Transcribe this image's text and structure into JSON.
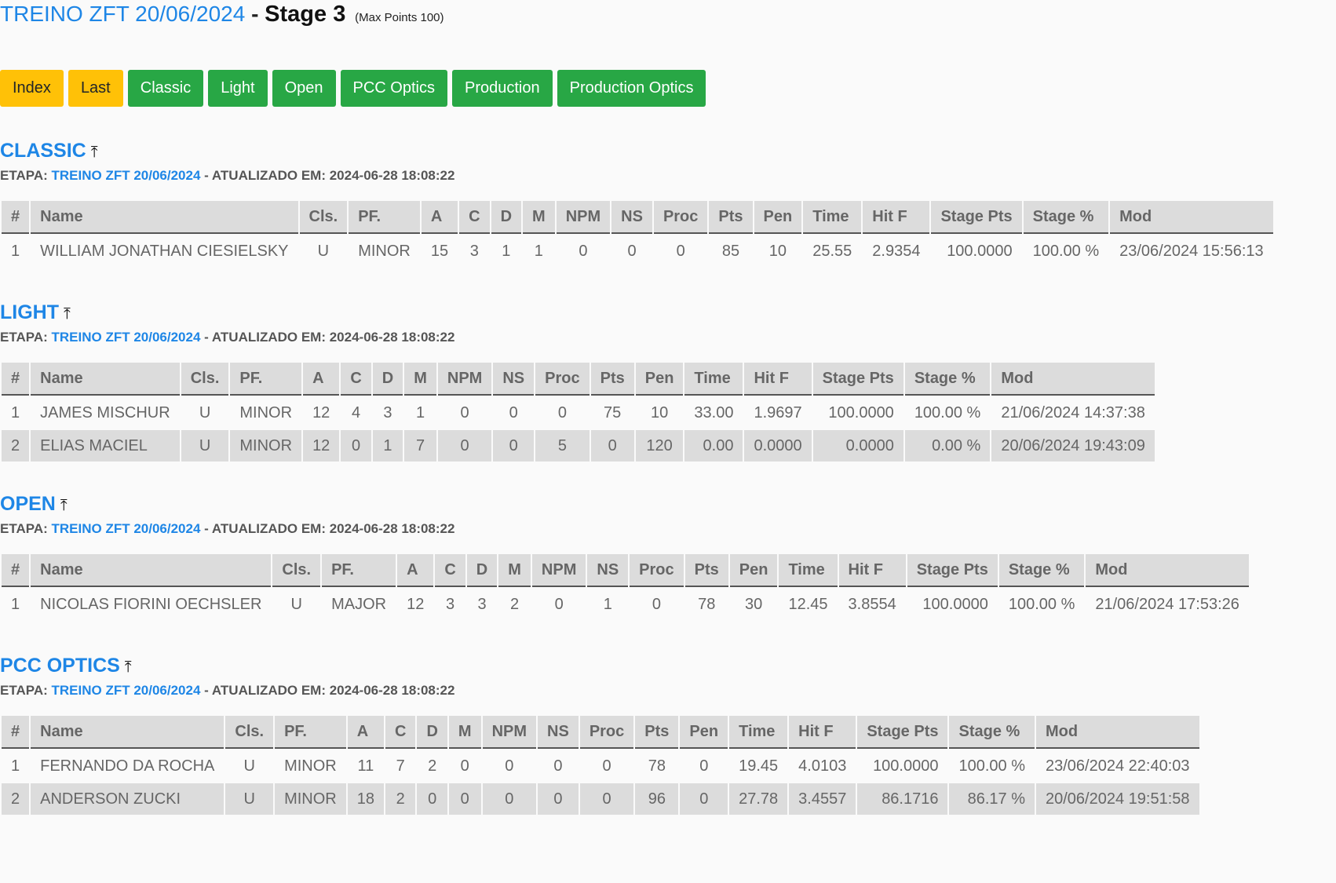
{
  "header": {
    "match_link": "TREINO ZFT 20/06/2024",
    "separator": "-",
    "stage": "Stage 3",
    "max_points": "(Max Points 100)"
  },
  "nav": {
    "index": "Index",
    "last": "Last",
    "classic": "Classic",
    "light": "Light",
    "open": "Open",
    "pcc_optics": "PCC Optics",
    "production": "Production",
    "production_optics": "Production Optics"
  },
  "top_icon": "arrow-to-top-icon",
  "top_glyph": "⤒",
  "columns": [
    "#",
    "Name",
    "Cls.",
    "PF.",
    "A",
    "C",
    "D",
    "M",
    "NPM",
    "NS",
    "Proc",
    "Pts",
    "Pen",
    "Time",
    "Hit F",
    "Stage Pts",
    "Stage %",
    "Mod"
  ],
  "sections": [
    {
      "title": "CLASSIC",
      "etapa_label": "ETAPA:",
      "match": "TREINO ZFT 20/06/2024",
      "updated": "- ATUALIZADO EM: 2024-06-28 18:08:22",
      "rows": [
        [
          "1",
          "WILLIAM JONATHAN CIESIELSKY",
          "U",
          "MINOR",
          "15",
          "3",
          "1",
          "1",
          "0",
          "0",
          "0",
          "85",
          "10",
          "25.55",
          "2.9354",
          "100.0000",
          "100.00 %",
          "23/06/2024 15:56:13"
        ]
      ]
    },
    {
      "title": "LIGHT",
      "etapa_label": "ETAPA:",
      "match": "TREINO ZFT 20/06/2024",
      "updated": "- ATUALIZADO EM: 2024-06-28 18:08:22",
      "rows": [
        [
          "1",
          "JAMES MISCHUR",
          "U",
          "MINOR",
          "12",
          "4",
          "3",
          "1",
          "0",
          "0",
          "0",
          "75",
          "10",
          "33.00",
          "1.9697",
          "100.0000",
          "100.00 %",
          "21/06/2024 14:37:38"
        ],
        [
          "2",
          "ELIAS MACIEL",
          "U",
          "MINOR",
          "12",
          "0",
          "1",
          "7",
          "0",
          "0",
          "5",
          "0",
          "120",
          "0.00",
          "0.0000",
          "0.0000",
          "0.00 %",
          "20/06/2024 19:43:09"
        ]
      ]
    },
    {
      "title": "OPEN",
      "etapa_label": "ETAPA:",
      "match": "TREINO ZFT 20/06/2024",
      "updated": "- ATUALIZADO EM: 2024-06-28 18:08:22",
      "rows": [
        [
          "1",
          "NICOLAS FIORINI OECHSLER",
          "U",
          "MAJOR",
          "12",
          "3",
          "3",
          "2",
          "0",
          "1",
          "0",
          "78",
          "30",
          "12.45",
          "3.8554",
          "100.0000",
          "100.00 %",
          "21/06/2024 17:53:26"
        ]
      ]
    },
    {
      "title": "PCC OPTICS",
      "etapa_label": "ETAPA:",
      "match": "TREINO ZFT 20/06/2024",
      "updated": "- ATUALIZADO EM: 2024-06-28 18:08:22",
      "rows": [
        [
          "1",
          "FERNANDO DA ROCHA",
          "U",
          "MINOR",
          "11",
          "7",
          "2",
          "0",
          "0",
          "0",
          "0",
          "78",
          "0",
          "19.45",
          "4.0103",
          "100.0000",
          "100.00 %",
          "23/06/2024 22:40:03"
        ],
        [
          "2",
          "ANDERSON ZUCKI",
          "U",
          "MINOR",
          "18",
          "2",
          "0",
          "0",
          "0",
          "0",
          "0",
          "96",
          "0",
          "27.78",
          "3.4557",
          "86.1716",
          "86.17 %",
          "20/06/2024 19:51:58"
        ]
      ]
    }
  ]
}
